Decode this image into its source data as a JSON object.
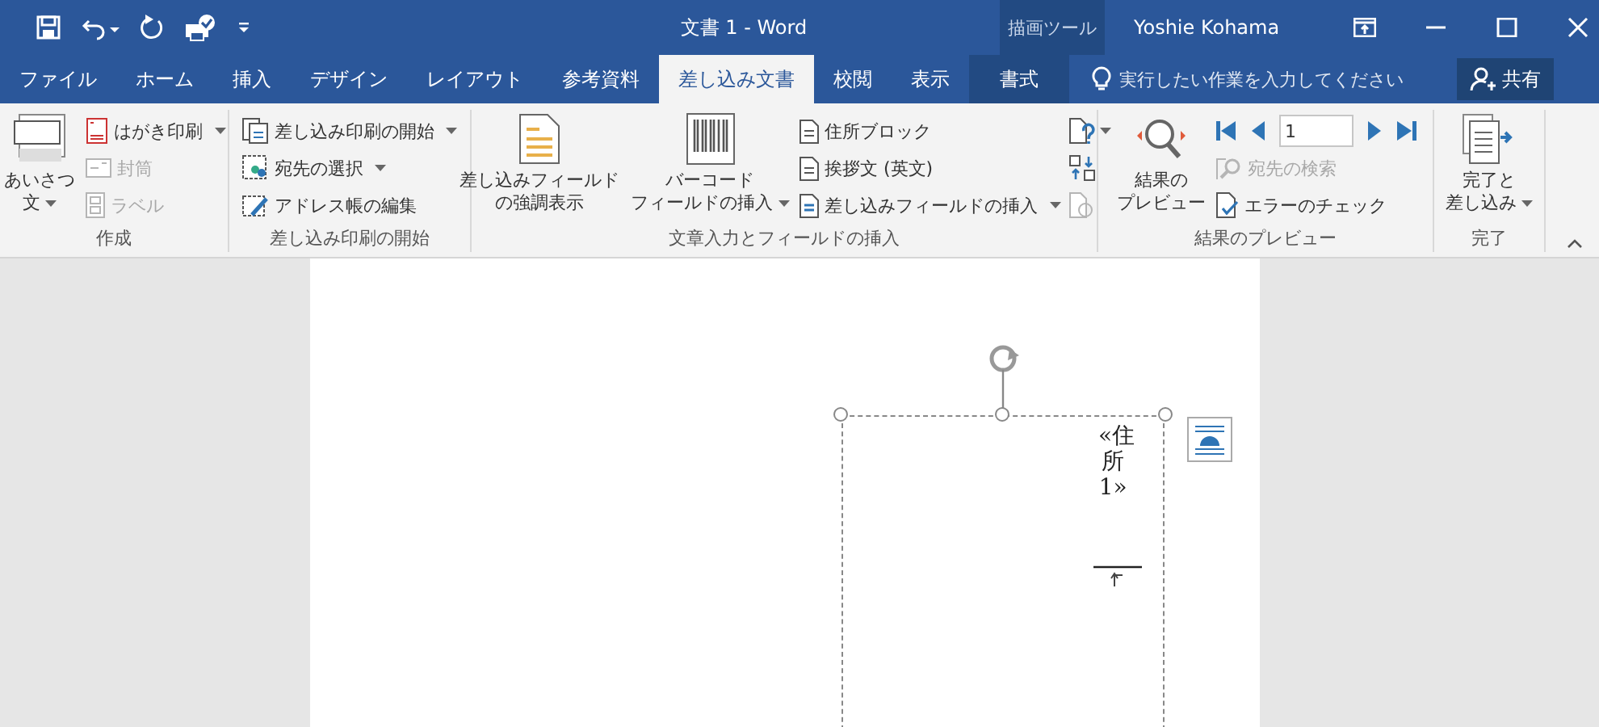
{
  "window": {
    "title": "文書 1 - Word",
    "context_tool": "描画ツール",
    "user": "Yoshie Kohama"
  },
  "tabs": [
    {
      "label": "ファイル",
      "selected": false,
      "kind": "normal"
    },
    {
      "label": "ホーム",
      "selected": false,
      "kind": "normal"
    },
    {
      "label": "挿入",
      "selected": false,
      "kind": "normal"
    },
    {
      "label": "デザイン",
      "selected": false,
      "kind": "normal"
    },
    {
      "label": "レイアウト",
      "selected": false,
      "kind": "normal"
    },
    {
      "label": "参考資料",
      "selected": false,
      "kind": "normal"
    },
    {
      "label": "差し込み文書",
      "selected": true,
      "kind": "normal"
    },
    {
      "label": "校閲",
      "selected": false,
      "kind": "normal"
    },
    {
      "label": "表示",
      "selected": false,
      "kind": "normal"
    },
    {
      "label": "書式",
      "selected": false,
      "kind": "contextual"
    }
  ],
  "tell_me": {
    "placeholder": "実行したい作業を入力してください"
  },
  "share": {
    "label": "共有"
  },
  "groups": [
    {
      "label": "作成",
      "items": [
        {
          "kind": "large",
          "lines": [
            "あいさつ",
            "文"
          ],
          "dropdown": true
        },
        {
          "kind": "column",
          "items": [
            {
              "kind": "small",
              "label": "はがき印刷",
              "dropdown": true,
              "disabled": false
            },
            {
              "kind": "small",
              "label": "封筒",
              "dropdown": false,
              "disabled": true
            },
            {
              "kind": "small",
              "label": "ラベル",
              "dropdown": false,
              "disabled": true
            }
          ]
        }
      ]
    },
    {
      "label": "差し込み印刷の開始",
      "items": [
        {
          "kind": "column",
          "items": [
            {
              "kind": "small",
              "label": "差し込み印刷の開始",
              "dropdown": true,
              "disabled": false
            },
            {
              "kind": "small",
              "label": "宛先の選択",
              "dropdown": true,
              "disabled": false
            },
            {
              "kind": "small",
              "label": "アドレス帳の編集",
              "dropdown": false,
              "disabled": false
            }
          ]
        }
      ]
    },
    {
      "label": "文章入力とフィールドの挿入",
      "items": [
        {
          "kind": "large",
          "lines": [
            "差し込みフィールド",
            "の強調表示"
          ],
          "dropdown": false
        },
        {
          "kind": "large",
          "lines": [
            "バーコード",
            "フィールドの挿入"
          ],
          "dropdown": true
        },
        {
          "kind": "column",
          "items": [
            {
              "kind": "small",
              "label": "住所ブロック",
              "dropdown": false,
              "disabled": false
            },
            {
              "kind": "small",
              "label": "挨拶文 (英文)",
              "dropdown": false,
              "disabled": false
            },
            {
              "kind": "small",
              "label": "差し込みフィールドの挿入",
              "dropdown": true,
              "disabled": false
            }
          ]
        },
        {
          "kind": "column",
          "items": [
            {
              "kind": "icon",
              "dropdown": true,
              "disabled": false
            },
            {
              "kind": "icon",
              "dropdown": false,
              "disabled": false
            },
            {
              "kind": "icon",
              "dropdown": false,
              "disabled": true
            }
          ]
        }
      ]
    },
    {
      "label": "結果のプレビュー",
      "items": [
        {
          "kind": "large",
          "lines": [
            "結果の",
            "プレビュー"
          ],
          "dropdown": false
        },
        {
          "kind": "column",
          "items": [
            {
              "kind": "nav",
              "value": "1"
            },
            {
              "kind": "small",
              "label": "宛先の検索",
              "dropdown": false,
              "disabled": true
            },
            {
              "kind": "small",
              "label": "エラーのチェック",
              "dropdown": false,
              "disabled": false
            }
          ]
        }
      ]
    },
    {
      "label": "完了",
      "items": [
        {
          "kind": "large",
          "lines": [
            "完了と",
            "差し込み"
          ],
          "dropdown": true
        }
      ]
    }
  ],
  "document": {
    "text_box": {
      "text": "«住所1»"
    }
  }
}
